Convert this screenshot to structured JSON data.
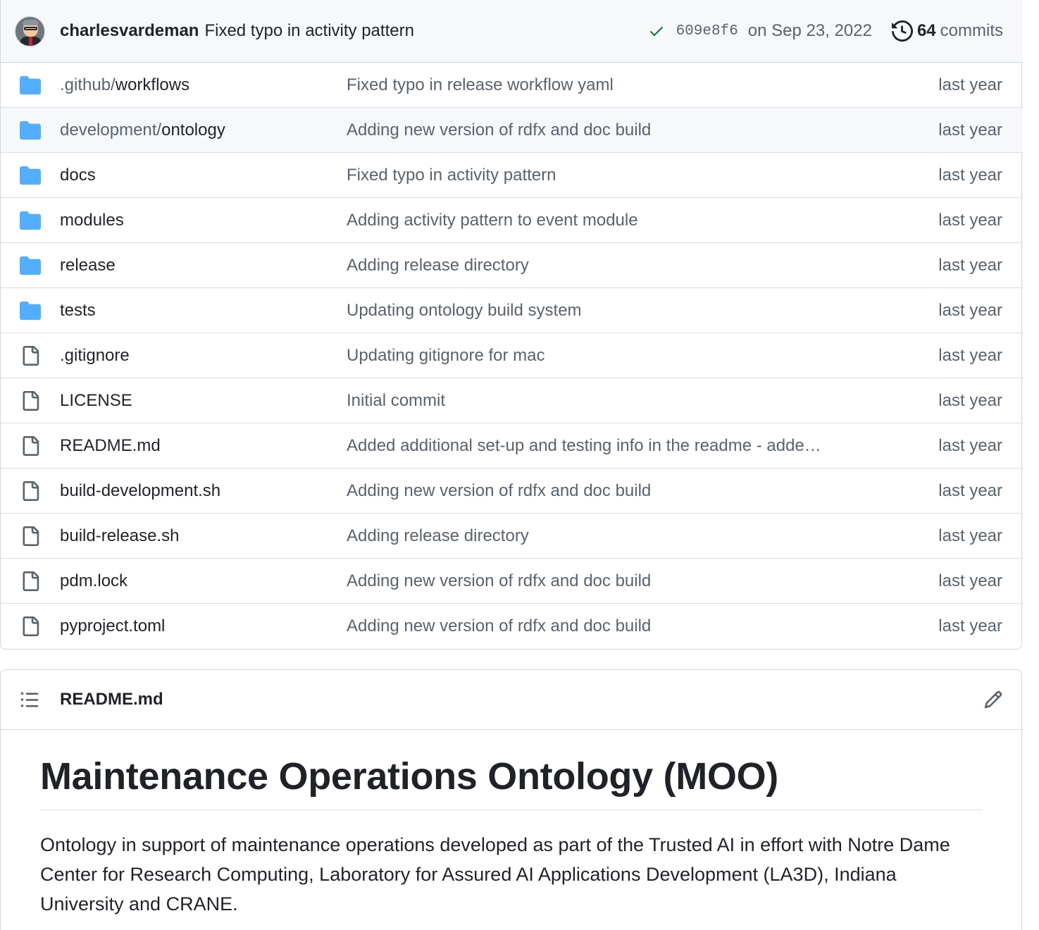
{
  "commit": {
    "author": "charlesvardeman",
    "message": "Fixed typo in activity pattern",
    "sha": "609e8f6",
    "date": "on Sep 23, 2022",
    "count": "64",
    "count_label": "commits",
    "status_color": "#1a7f37"
  },
  "files": [
    {
      "type": "folder",
      "prefix": ".github/",
      "name": "workflows",
      "message": "Fixed typo in release workflow yaml",
      "age": "last year"
    },
    {
      "type": "folder",
      "prefix": "development/",
      "name": "ontology",
      "message": "Adding new version of rdfx and doc build",
      "age": "last year",
      "hover": true
    },
    {
      "type": "folder",
      "prefix": "",
      "name": "docs",
      "message": "Fixed typo in activity pattern",
      "age": "last year"
    },
    {
      "type": "folder",
      "prefix": "",
      "name": "modules",
      "message": "Adding activity pattern to event module",
      "age": "last year"
    },
    {
      "type": "folder",
      "prefix": "",
      "name": "release",
      "message": "Adding release directory",
      "age": "last year"
    },
    {
      "type": "folder",
      "prefix": "",
      "name": "tests",
      "message": "Updating ontology build system",
      "age": "last year"
    },
    {
      "type": "file",
      "prefix": "",
      "name": ".gitignore",
      "message": "Updating gitignore for mac",
      "age": "last year"
    },
    {
      "type": "file",
      "prefix": "",
      "name": "LICENSE",
      "message": "Initial commit",
      "age": "last year"
    },
    {
      "type": "file",
      "prefix": "",
      "name": "README.md",
      "message": "Added additional set-up and testing info in the readme - adde…",
      "age": "last year"
    },
    {
      "type": "file",
      "prefix": "",
      "name": "build-development.sh",
      "message": "Adding new version of rdfx and doc build",
      "age": "last year"
    },
    {
      "type": "file",
      "prefix": "",
      "name": "build-release.sh",
      "message": "Adding release directory",
      "age": "last year"
    },
    {
      "type": "file",
      "prefix": "",
      "name": "pdm.lock",
      "message": "Adding new version of rdfx and doc build",
      "age": "last year"
    },
    {
      "type": "file",
      "prefix": "",
      "name": "pyproject.toml",
      "message": "Adding new version of rdfx and doc build",
      "age": "last year"
    }
  ],
  "icons": {
    "folder": "folder-icon",
    "file": "file-icon",
    "folder_color": "#54aeff",
    "file_color": "#59636e"
  },
  "readme": {
    "filename": "README.md",
    "heading": "Maintenance Operations Ontology (MOO)",
    "paragraph": "Ontology in support of maintenance operations developed as part of the Trusted AI in effort with Notre Dame Center for Research Computing, Laboratory for Assured AI Applications Development (LA3D), Indiana University and CRANE."
  }
}
